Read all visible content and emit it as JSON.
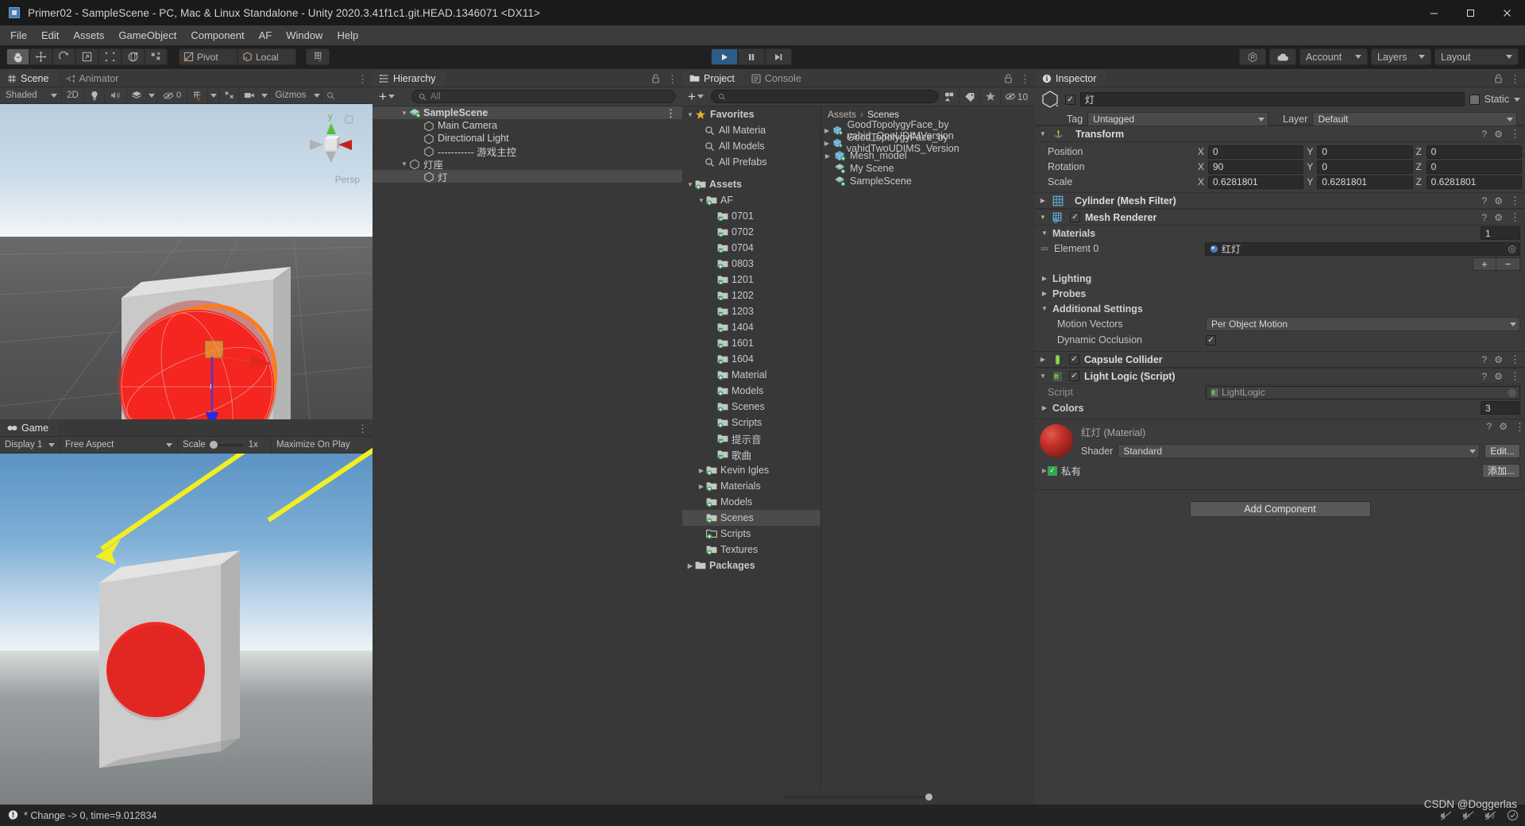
{
  "window": {
    "title": "Primer02 - SampleScene - PC, Mac & Linux Standalone - Unity 2020.3.41f1c1.git.HEAD.1346071 <DX11>",
    "minimize": "–",
    "maximize": "❐",
    "close": "✕"
  },
  "menubar": {
    "items": [
      "File",
      "Edit",
      "Assets",
      "GameObject",
      "Component",
      "AF",
      "Window",
      "Help"
    ]
  },
  "toolbar": {
    "tools": [
      {
        "name": "hand-tool",
        "selected": true
      },
      {
        "name": "move-tool",
        "selected": false
      },
      {
        "name": "rotate-tool",
        "selected": false
      },
      {
        "name": "scale-tool",
        "selected": false
      },
      {
        "name": "rect-tool",
        "selected": false
      },
      {
        "name": "transform-tool",
        "selected": false
      },
      {
        "name": "custom-tool",
        "selected": false
      }
    ],
    "pivot_label": "Pivot",
    "local_label": "Local",
    "grid_label": "",
    "play_label": "▶",
    "pause_label": "❚❚",
    "step_label": "▶|",
    "collab_label": "",
    "cloud_label": "",
    "account_label": "Account",
    "layers_label": "Layers",
    "layout_label": "Layout"
  },
  "scene_panel": {
    "tabs": [
      {
        "label": "Scene",
        "icon": "grid-icon",
        "active": true
      },
      {
        "label": "Animator",
        "icon": "animator-icon",
        "active": false
      }
    ],
    "shading_mode": "Shaded",
    "toggle_2d": "2D",
    "hidden_count": "0",
    "gizmos_label": "Gizmos",
    "persp_label": "Persp",
    "axis_x": "x",
    "axis_y": "y"
  },
  "game_panel": {
    "tab_label": "Game",
    "display": "Display 1",
    "aspect": "Free Aspect",
    "scale_label": "Scale",
    "scale_value": "1x",
    "maximize_label": "Maximize On Play"
  },
  "hierarchy": {
    "tab_label": "Hierarchy",
    "search_placeholder": "All",
    "rows": [
      {
        "label": "SampleScene",
        "depth": 0,
        "icon": "scene-icon",
        "expanded": true,
        "selected": false,
        "isScene": true
      },
      {
        "label": "Main Camera",
        "depth": 2,
        "icon": "gameobject-icon",
        "expanded": null,
        "selected": false
      },
      {
        "label": "Directional Light",
        "depth": 2,
        "icon": "gameobject-icon",
        "expanded": null,
        "selected": false
      },
      {
        "label": "----------- 游戏主控",
        "depth": 2,
        "icon": "gameobject-icon",
        "expanded": null,
        "selected": false
      },
      {
        "label": "灯座",
        "depth": 1,
        "icon": "gameobject-icon",
        "expanded": true,
        "selected": false
      },
      {
        "label": "灯",
        "depth": 2,
        "icon": "gameobject-icon",
        "expanded": null,
        "selected": true
      }
    ]
  },
  "project": {
    "tabs": [
      {
        "label": "Project",
        "icon": "folder-icon",
        "active": true
      },
      {
        "label": "Console",
        "icon": "console-icon",
        "active": false
      }
    ],
    "search_placeholder": "",
    "hidden_count": "10",
    "breadcrumb": [
      "Assets",
      "Scenes"
    ],
    "tree": [
      {
        "label": "Favorites",
        "depth": 0,
        "icon": "star-icon",
        "expanded": true,
        "bold": true
      },
      {
        "label": "All Materia",
        "depth": 1,
        "icon": "search-icon"
      },
      {
        "label": "All Models",
        "depth": 1,
        "icon": "search-icon"
      },
      {
        "label": "All Prefabs",
        "depth": 1,
        "icon": "search-icon"
      },
      {
        "label": "",
        "depth": 0,
        "icon": "spacer"
      },
      {
        "label": "Assets",
        "depth": 0,
        "icon": "folder-green-icon",
        "expanded": true,
        "bold": true
      },
      {
        "label": "AF",
        "depth": 1,
        "icon": "folder-green-icon",
        "expanded": true
      },
      {
        "label": "0701",
        "depth": 2,
        "icon": "folder-script-icon"
      },
      {
        "label": "0702",
        "depth": 2,
        "icon": "folder-script-icon"
      },
      {
        "label": "0704",
        "depth": 2,
        "icon": "folder-script-icon"
      },
      {
        "label": "0803",
        "depth": 2,
        "icon": "folder-green-icon"
      },
      {
        "label": "1201",
        "depth": 2,
        "icon": "folder-script-icon"
      },
      {
        "label": "1202",
        "depth": 2,
        "icon": "folder-script-icon"
      },
      {
        "label": "1203",
        "depth": 2,
        "icon": "folder-script-icon"
      },
      {
        "label": "1404",
        "depth": 2,
        "icon": "folder-script-icon"
      },
      {
        "label": "1601",
        "depth": 2,
        "icon": "folder-script-icon"
      },
      {
        "label": "1604",
        "depth": 2,
        "icon": "folder-script-icon"
      },
      {
        "label": "Material",
        "depth": 2,
        "icon": "folder-green-icon"
      },
      {
        "label": "Models",
        "depth": 2,
        "icon": "folder-green-icon"
      },
      {
        "label": "Scenes",
        "depth": 2,
        "icon": "folder-green-icon"
      },
      {
        "label": "Scripts",
        "depth": 2,
        "icon": "folder-green-icon"
      },
      {
        "label": "提示音",
        "depth": 2,
        "icon": "folder-script-icon"
      },
      {
        "label": "歌曲",
        "depth": 2,
        "icon": "folder-script-icon"
      },
      {
        "label": "Kevin Igles",
        "depth": 1,
        "icon": "folder-green-icon",
        "expanded": false
      },
      {
        "label": "Materials",
        "depth": 1,
        "icon": "folder-green-icon",
        "expanded": false
      },
      {
        "label": "Models",
        "depth": 1,
        "icon": "folder-green-icon"
      },
      {
        "label": "Scenes",
        "depth": 1,
        "icon": "folder-green-icon",
        "selected": true
      },
      {
        "label": "Scripts",
        "depth": 1,
        "icon": "folder-open-icon"
      },
      {
        "label": "Textures",
        "depth": 1,
        "icon": "folder-green-icon"
      },
      {
        "label": "Packages",
        "depth": 0,
        "icon": "folder-plain-icon",
        "expanded": false,
        "bold": true
      }
    ],
    "items": [
      {
        "label": "GoodTopolygyFace_by vahid_OneUDIMVersion",
        "icon": "prefab-icon",
        "expandable": true
      },
      {
        "label": "GoodTopolygyFace_by vahidTwoUDIMS_Version",
        "icon": "prefab-icon",
        "expandable": true
      },
      {
        "label": "Mesh_model",
        "icon": "prefab-icon",
        "expandable": true
      },
      {
        "label": "My Scene",
        "icon": "unity-scene-icon",
        "expandable": false
      },
      {
        "label": "SampleScene",
        "icon": "unity-scene-icon",
        "expandable": false
      }
    ]
  },
  "inspector": {
    "tab_label": "Inspector",
    "object_name": "灯",
    "enabled": true,
    "static_label": "Static",
    "tag_label": "Tag",
    "tag_value": "Untagged",
    "layer_label": "Layer",
    "layer_value": "Default",
    "transform": {
      "title": "Transform",
      "rows": [
        {
          "label": "Position",
          "x": "0",
          "y": "0",
          "z": "0"
        },
        {
          "label": "Rotation",
          "x": "90",
          "y": "0",
          "z": "0"
        },
        {
          "label": "Scale",
          "x": "0.6281801",
          "y": "0.6281801",
          "z": "0.6281801"
        }
      ]
    },
    "mesh_filter": {
      "title": "Cylinder (Mesh Filter)"
    },
    "mesh_renderer": {
      "title": "Mesh Renderer",
      "materials_label": "Materials",
      "materials_count": "1",
      "element_label": "Element 0",
      "element_value": "红灯",
      "lighting_label": "Lighting",
      "probes_label": "Probes",
      "additional_label": "Additional Settings",
      "motion_vectors_label": "Motion Vectors",
      "motion_vectors_value": "Per Object Motion",
      "dynamic_occlusion_label": "Dynamic Occlusion",
      "add_btn": "+",
      "remove_btn": "−"
    },
    "capsule_collider": {
      "title": "Capsule Collider"
    },
    "light_logic": {
      "title": "Light Logic (Script)",
      "script_label": "Script",
      "script_value": "LightLogic",
      "colors_label": "Colors",
      "colors_count": "3"
    },
    "material": {
      "title": "红灯 (Material)",
      "shader_label": "Shader",
      "shader_value": "Standard",
      "edit_label": "Edit...",
      "private_label": "私有",
      "add_label": "添加..."
    },
    "add_component_label": "Add Component"
  },
  "statusbar": {
    "message": "* Change -> 0, time=9.012834",
    "watermark": "CSDN @Doggerlas"
  },
  "colors": {
    "accent_blue": "#2c5d87",
    "panel_bg": "#383838",
    "toolbar_bg": "#202020",
    "selection": "#4b4b4b",
    "red_material": "#e8252a",
    "orange_outline": "#ff7b1a",
    "yellow_arrow": "#f2ee22"
  }
}
